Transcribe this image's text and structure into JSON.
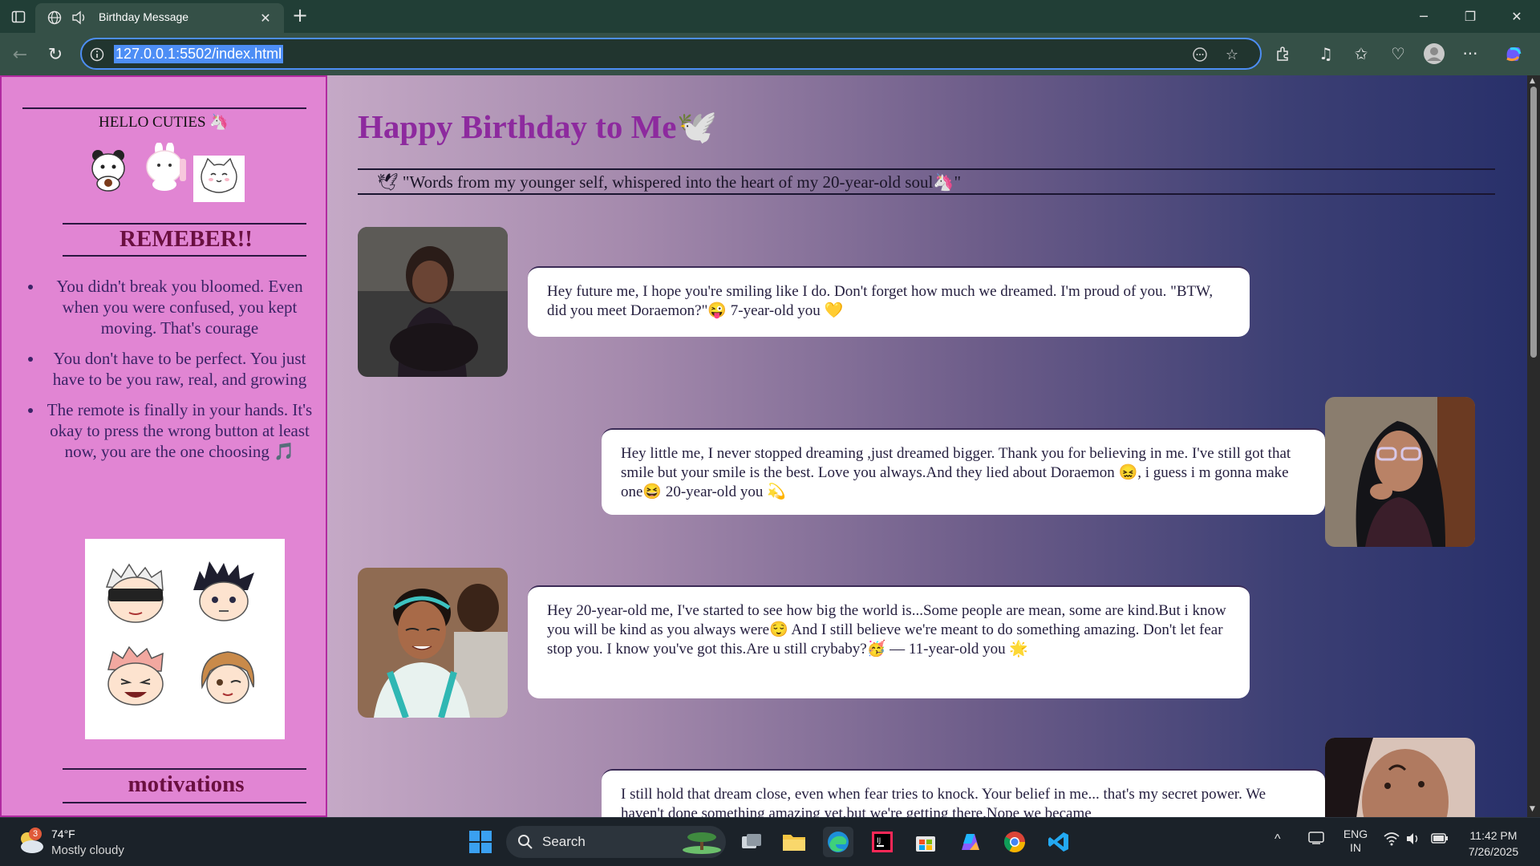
{
  "browser": {
    "tab_title": "Birthday Message",
    "url": "127.0.0.1:5502/index.html"
  },
  "sidebar": {
    "hello": "HELLO CUTIES 🦄",
    "remember_heading": "REMEBER!!",
    "remember_items": [
      "You didn't break you bloomed. Even when you were confused, you kept moving. That's courage",
      "You don't have to be perfect. You just have to be you raw, real, and growing",
      "The remote is finally in your hands. It's okay to press the wrong button at least now, you are the one choosing 🎵"
    ],
    "motivations_heading": "motivations"
  },
  "main": {
    "title": "Happy Birthday to Me🕊️",
    "quote": "🕊 \"Words from my younger self, whispered into the heart of my 20-year-old soul🦄\"",
    "messages": [
      {
        "side": "left",
        "text": "Hey future me, I hope you're smiling like I do. Don't forget how much we dreamed. I'm proud of you. \"BTW, did you meet Doraemon?\"😜 7-year-old you 💛"
      },
      {
        "side": "right",
        "text": "Hey little me, I never stopped dreaming ,just dreamed bigger. Thank you for believing in me. I've still got that smile but your smile is the best. Love you always.And they lied about Doraemon 😖, i guess i m gonna make one😆 20-year-old you 💫"
      },
      {
        "side": "left",
        "text": "Hey 20-year-old me, I've started to see how big the world is...Some people are mean, some are kind.But i know you will be kind as you always were😌 And I still believe we're meant to do something amazing. Don't let fear stop you. I know you've got this.Are u still crybaby?🥳 — 11-year-old you 🌟"
      },
      {
        "side": "right",
        "text": "I still hold that dream close, even when fear tries to knock. Your belief in me... that's my secret power. We haven't done something amazing yet,but we're getting there.Nope we became"
      }
    ]
  },
  "taskbar": {
    "weather_temp": "74°F",
    "weather_desc": "Mostly cloudy",
    "weather_badge": "3",
    "search_label": "Search",
    "lang_top": "ENG",
    "lang_bottom": "IN",
    "time": "11:42 PM",
    "date": "7/26/2025"
  },
  "colors": {
    "titlebar": "#213e36",
    "sidebar_bg": "#e185d3",
    "title_purple": "#8d2a9e",
    "heading_maroon": "#6a1040",
    "url_highlight": "#4d8ef5"
  },
  "icons": [
    "sidebar-toggle-icon",
    "globe-icon",
    "speaker-icon",
    "close-icon",
    "plus-icon",
    "back-icon",
    "reload-icon",
    "info-icon",
    "reading-icon",
    "star-icon",
    "extensions-icon",
    "music-icon",
    "favorites-icon",
    "health-icon",
    "profile-icon",
    "more-icon",
    "copilot-icon"
  ]
}
